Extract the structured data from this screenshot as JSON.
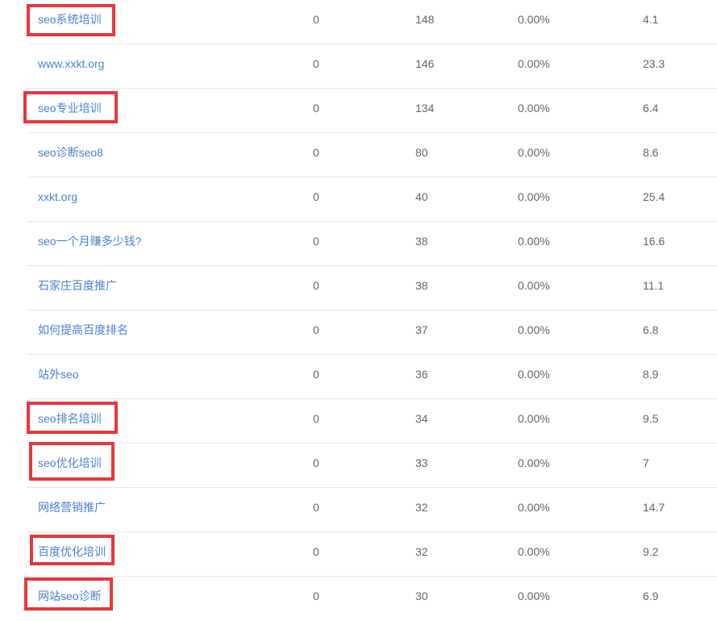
{
  "rows": [
    {
      "keyword": "seo系统培训",
      "col2": "0",
      "col3": "148",
      "col4": "0.00%",
      "col5": "4.1",
      "highlighted": true
    },
    {
      "keyword": "www.xxkt.org",
      "col2": "0",
      "col3": "146",
      "col4": "0.00%",
      "col5": "23.3",
      "highlighted": false
    },
    {
      "keyword": "seo专业培训",
      "col2": "0",
      "col3": "134",
      "col4": "0.00%",
      "col5": "6.4",
      "highlighted": true
    },
    {
      "keyword": "seo诊断seo8",
      "col2": "0",
      "col3": "80",
      "col4": "0.00%",
      "col5": "8.6",
      "highlighted": false
    },
    {
      "keyword": "xxkt.org",
      "col2": "0",
      "col3": "40",
      "col4": "0.00%",
      "col5": "25.4",
      "highlighted": false
    },
    {
      "keyword": "seo一个月赚多少钱?",
      "col2": "0",
      "col3": "38",
      "col4": "0.00%",
      "col5": "16.6",
      "highlighted": false
    },
    {
      "keyword": "石家庄百度推广",
      "col2": "0",
      "col3": "38",
      "col4": "0.00%",
      "col5": "11.1",
      "highlighted": false
    },
    {
      "keyword": "如何提高百度排名",
      "col2": "0",
      "col3": "37",
      "col4": "0.00%",
      "col5": "6.8",
      "highlighted": false
    },
    {
      "keyword": "站外seo",
      "col2": "0",
      "col3": "36",
      "col4": "0.00%",
      "col5": "8.9",
      "highlighted": false
    },
    {
      "keyword": "seo排名培训",
      "col2": "0",
      "col3": "34",
      "col4": "0.00%",
      "col5": "9.5",
      "highlighted": true
    },
    {
      "keyword": "seo优化培训",
      "col2": "0",
      "col3": "33",
      "col4": "0.00%",
      "col5": "7",
      "highlighted": true
    },
    {
      "keyword": "网络营销推广",
      "col2": "0",
      "col3": "32",
      "col4": "0.00%",
      "col5": "14.7",
      "highlighted": false
    },
    {
      "keyword": "百度优化培训",
      "col2": "0",
      "col3": "32",
      "col4": "0.00%",
      "col5": "9.2",
      "highlighted": true
    },
    {
      "keyword": "网站seo诊断",
      "col2": "0",
      "col3": "30",
      "col4": "0.00%",
      "col5": "6.9",
      "highlighted": true
    }
  ],
  "colors": {
    "keyword_link": "#4a7fd6",
    "value_text": "#666666",
    "row_divider": "#e8e8e8",
    "highlight_border": "#e8373c"
  }
}
